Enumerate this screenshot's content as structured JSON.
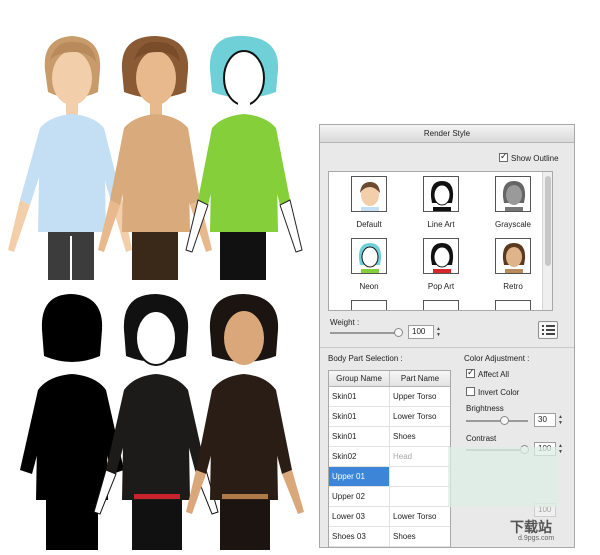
{
  "panel": {
    "title": "Render Style",
    "show_outline": {
      "label": "Show Outline",
      "checked": true
    },
    "styles": [
      {
        "label": "Default",
        "icon": "default-style-thumb"
      },
      {
        "label": "Line Art",
        "icon": "line-art-style-thumb"
      },
      {
        "label": "Grayscale",
        "icon": "grayscale-style-thumb"
      },
      {
        "label": "Neon",
        "icon": "neon-style-thumb"
      },
      {
        "label": "Pop Art",
        "icon": "pop-art-style-thumb"
      },
      {
        "label": "Retro",
        "icon": "retro-style-thumb"
      }
    ],
    "weight": {
      "label": "Weight :",
      "value": "100"
    },
    "body_part": {
      "label": "Body Part Selection :",
      "columns": [
        "Group Name",
        "Part Name"
      ],
      "rows": [
        {
          "group": "Skin01",
          "part": "Upper Torso"
        },
        {
          "group": "Skin01",
          "part": "Lower Torso"
        },
        {
          "group": "Skin01",
          "part": "Shoes"
        },
        {
          "group": "Skin02",
          "part": "Head"
        },
        {
          "group": "Upper 01",
          "part": ""
        },
        {
          "group": "Upper 02",
          "part": ""
        },
        {
          "group": "Lower 03",
          "part": "Lower Torso"
        },
        {
          "group": "Shoes 03",
          "part": "Shoes"
        }
      ]
    },
    "color_adjustment": {
      "label": "Color Adjustment :",
      "affect_all": {
        "label": "Affect All",
        "checked": true
      },
      "invert_color": {
        "label": "Invert Color",
        "checked": false
      },
      "brightness": {
        "label": "Brightness",
        "value": "30"
      },
      "contrast": {
        "label": "Contrast",
        "value": "100"
      },
      "third_value": "100"
    }
  },
  "watermark": "下载站",
  "watermark_sub": "d.9pgs.com"
}
